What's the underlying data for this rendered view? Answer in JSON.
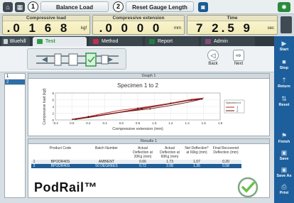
{
  "topbar": {
    "channel1_number": "1",
    "channel1_label": "Balance Load",
    "channel2_number": "2",
    "channel2_label": "Reset Gauge Length"
  },
  "readouts": [
    {
      "label": "Compressive load",
      "value": ".0 1 6 8",
      "unit": "kgf"
    },
    {
      "label": "Compressive extension",
      "value": ".0 0 0 0",
      "unit": "mm"
    },
    {
      "label": "Time",
      "value": "7 2.5 9",
      "unit": "sec"
    }
  ],
  "tabs": [
    {
      "label": "Test",
      "color": "#2e9c46"
    },
    {
      "label": "Method",
      "color": "#c22e4e"
    },
    {
      "label": "Report",
      "color": "#1e7e3f"
    },
    {
      "label": "Admin",
      "color": "#8a4a7a"
    }
  ],
  "home_button": "Bluehill",
  "sidebar": [
    {
      "label": "Start",
      "icon": "play-icon"
    },
    {
      "label": "Stop",
      "icon": "stop-icon"
    },
    {
      "label": "Return",
      "icon": "return-icon"
    },
    {
      "label": "Reset",
      "icon": "reset-icon"
    },
    {
      "label": "Finish",
      "icon": "finish-flag-icon"
    },
    {
      "label": "Save",
      "icon": "save-icon"
    },
    {
      "label": "Save As",
      "icon": "save-as-icon"
    },
    {
      "label": "Print",
      "icon": "print-icon"
    }
  ],
  "workflow": {
    "back_label": "Back",
    "next_label": "Next"
  },
  "leftlist": {
    "rows": [
      "1",
      "2"
    ]
  },
  "graph": {
    "panel_title": "Graph 1",
    "legend_title": "Specimen #"
  },
  "chart_data": {
    "type": "line",
    "title": "Specimen 1 to 2",
    "xlabel": "Compressive extension (mm)",
    "ylabel": "Compressive load (kgf)",
    "xlim": [
      -0.2,
      1.8
    ],
    "ylim": [
      0,
      8
    ],
    "xticks": [
      "-0.2",
      "0.0",
      "0.2",
      "0.4",
      "0.6",
      "0.8",
      "1.0",
      "1.2",
      "1.4",
      "1.6",
      "1.8"
    ],
    "yticks": [
      "0",
      "2",
      "4",
      "6",
      "8"
    ],
    "series": [
      {
        "name": "1",
        "color": "#b52a2a",
        "x": [
          0.0,
          0.2,
          0.4,
          0.6,
          0.8,
          1.0,
          1.2,
          1.45,
          1.6,
          1.45,
          1.2,
          0.9,
          0.6,
          0.3,
          0.05
        ],
        "y": [
          0.2,
          1.0,
          2.0,
          2.9,
          3.5,
          4.2,
          5.0,
          5.9,
          6.5,
          6.1,
          5.0,
          3.7,
          2.4,
          1.2,
          0.3
        ]
      },
      {
        "name": "2",
        "color": "#6a1010",
        "x": [
          0.0,
          0.2,
          0.45,
          0.7,
          0.95,
          1.2,
          1.4,
          1.58,
          1.4,
          1.15,
          0.85,
          0.55,
          0.25,
          0.05
        ],
        "y": [
          0.1,
          0.8,
          1.8,
          2.6,
          3.3,
          4.3,
          5.2,
          6.2,
          5.7,
          4.6,
          3.3,
          2.1,
          0.9,
          0.2
        ]
      }
    ]
  },
  "results": {
    "panel_title": "Results 1",
    "headers": [
      "",
      "Product Code",
      "Batch Number",
      "Actual Deflection at 20Kg (mm)",
      "Actual Deflection at 60Kg (mm)",
      "Net Deflection* at 60kg (mm)",
      "Final Recovered Deflection (mm)"
    ],
    "rows": [
      [
        "1",
        "BPODR40S",
        "AMBIENT",
        "0.66",
        "1.73",
        "1.07",
        "0.20"
      ],
      [
        "2",
        "BPODR40S",
        "50 DEGREES",
        "0.72",
        "2.08",
        "1.35",
        "0.58"
      ]
    ]
  },
  "brand": "PodRail™"
}
